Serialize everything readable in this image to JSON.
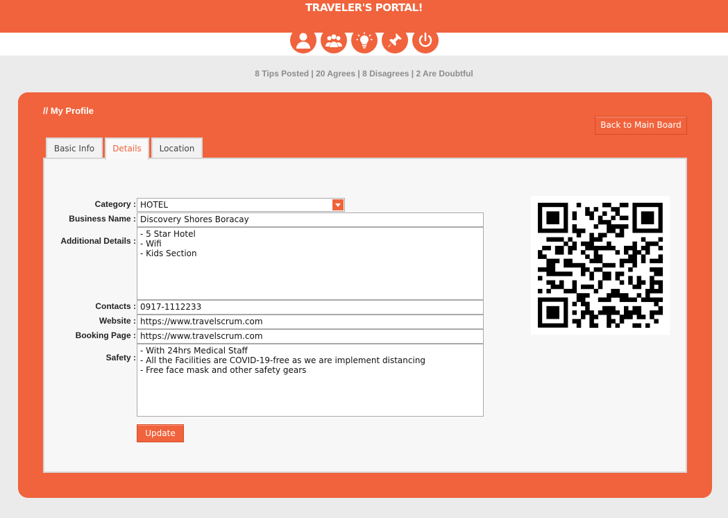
{
  "header": {
    "brand": "TRAVELER'S PORTAL!",
    "nav_icons": [
      "user-icon",
      "group-icon",
      "lightbulb-icon",
      "pin-icon",
      "power-icon"
    ]
  },
  "stats": "8 Tips Posted | 20 Agrees | 8 Disagrees | 2 Are Doubtful",
  "profile": {
    "title": "// My Profile",
    "back_label": "Back to Main Board",
    "tabs": [
      {
        "label": "Basic Info",
        "active": false
      },
      {
        "label": "Details",
        "active": true
      },
      {
        "label": "Location",
        "active": false
      }
    ]
  },
  "form": {
    "category_label": "Category :",
    "category_value": "HOTEL",
    "business_label": "Business Name :",
    "business_value": "Discovery Shores Boracay",
    "details_label": "Additional Details :",
    "details_value": "- 5 Star Hotel\n- Wifi\n- Kids Section",
    "contacts_label": "Contacts :",
    "contacts_value": "0917-1112233",
    "website_label": "Website :",
    "website_value": "https://www.travelscrum.com",
    "booking_label": "Booking Page :",
    "booking_value": "https://www.travelscrum.com",
    "safety_label": "Safety :",
    "safety_value": "- With 24hrs Medical Staff\n- All the Facilities are COVID-19-free as we are implement distancing\n- Free face mask and other safety gears",
    "update_label": "Update"
  },
  "colors": {
    "accent": "#f0633c",
    "background": "#ebebeb",
    "panel_inner": "#f7f7f7"
  }
}
